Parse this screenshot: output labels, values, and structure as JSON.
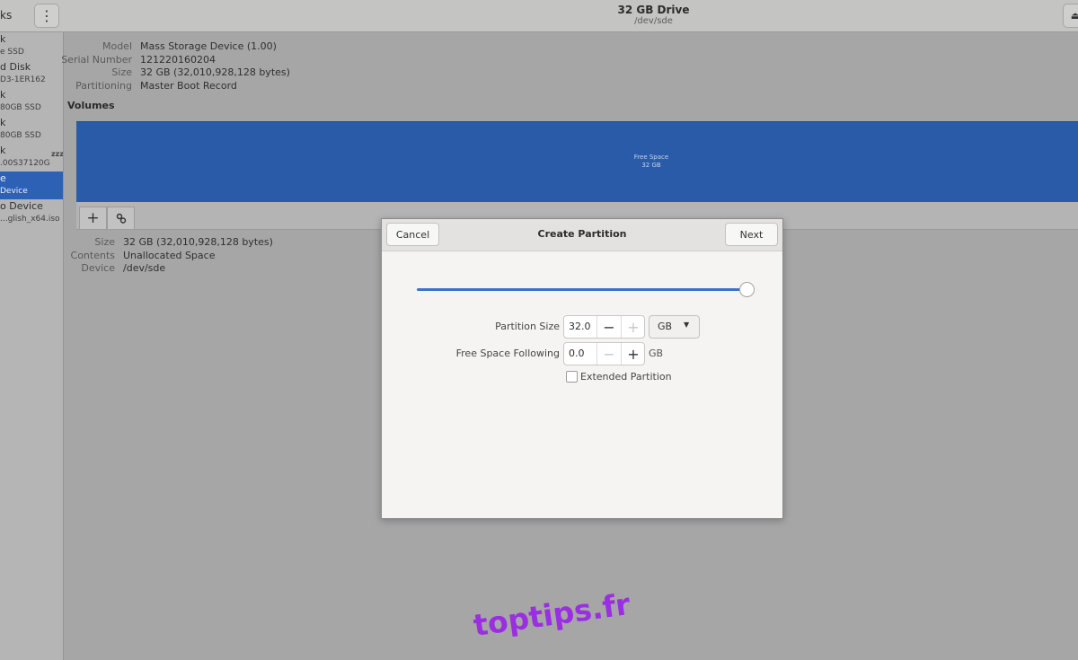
{
  "window": {
    "sidebar_title": "ks",
    "title": "32 GB Drive",
    "subtitle": "/dev/sde",
    "menu_icon": "vertical-dots-icon",
    "eject_icon": "eject-icon"
  },
  "sidebar": {
    "items": [
      {
        "line1": "k",
        "line2": "e SSD"
      },
      {
        "line1": "d Disk",
        "line2": "D3-1ER162"
      },
      {
        "line1": "k",
        "line2": "80GB SSD"
      },
      {
        "line1": "k",
        "line2": "80GB SSD"
      },
      {
        "line1": "k",
        "line2": ".00S37120G"
      },
      {
        "line1": "e",
        "line2": "Device"
      },
      {
        "line1": "o Device",
        "line2": "...glish_x64.iso"
      }
    ],
    "selected_index": 5,
    "sleep_badge": "zzz"
  },
  "drive_info": {
    "model_label": "Model",
    "model_value": "Mass Storage Device (1.00)",
    "serial_label": "Serial Number",
    "serial_value": "121220160204",
    "size_label": "Size",
    "size_value": "32 GB (32,010,928,128 bytes)",
    "partitioning_label": "Partitioning",
    "partitioning_value": "Master Boot Record"
  },
  "volumes": {
    "heading": "Volumes",
    "free_space_label": "Free Space",
    "free_space_size": "32 GB",
    "bar_color": "#2a5ba8",
    "toolbar": {
      "add_symbol": "+",
      "settings_icon": "gears-icon"
    }
  },
  "selection_info": {
    "size_label": "Size",
    "size_value": "32 GB (32,010,928,128 bytes)",
    "contents_label": "Contents",
    "contents_value": "Unallocated Space",
    "device_label": "Device",
    "device_value": "/dev/sde"
  },
  "dialog": {
    "title": "Create Partition",
    "cancel_label": "Cancel",
    "next_label": "Next",
    "slider_fraction": 1.0,
    "partition_size_label": "Partition Size",
    "partition_size_value": "32.0",
    "size_unit": "GB",
    "free_space_label": "Free Space Following",
    "free_space_value": "0.0",
    "free_space_unit": "GB",
    "extended_label": "Extended Partition",
    "extended_checked": false,
    "minus_symbol": "−",
    "plus_symbol": "+"
  },
  "watermark": "toptips.fr",
  "colors": {
    "accent": "#3b73c9",
    "selected_row": "#2d61b5",
    "watermark": "#9a2ee0"
  }
}
